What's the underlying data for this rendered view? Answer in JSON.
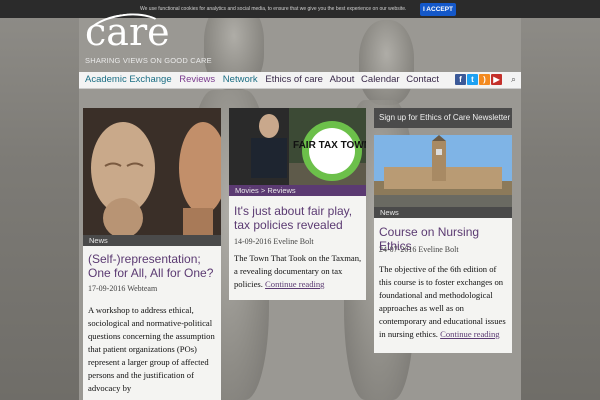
{
  "cookie": {
    "message": "We use functional cookies for analytics and social media, to ensure that we give you the best experience on our website.",
    "accept_label": "I ACCEPT"
  },
  "branding": {
    "logo_text": "care",
    "tagline": "SHARING VIEWS ON GOOD CARE"
  },
  "nav": {
    "left": [
      {
        "label": "Academic Exchange",
        "color": "#1a6e84"
      },
      {
        "label": "Reviews",
        "color": "#7a3a8e"
      },
      {
        "label": "Network",
        "color": "#1a6e84"
      }
    ],
    "right": [
      "Ethics of care",
      "About",
      "Calendar",
      "Contact"
    ],
    "social_icons": [
      "facebook-icon",
      "twitter-icon",
      "rss-icon",
      "youtube-icon"
    ]
  },
  "cards": [
    {
      "tag": "News",
      "title": "(Self-)representation; One for All, All for One?",
      "date": "17-09-2016",
      "author": "Webteam",
      "body": "A workshop to address ethical, sociological and normative-political questions concerning the assumption that patient organizations (POs) represent a larger group of affected persons and the justification of advocacy by"
    },
    {
      "tag_movies": "Movies",
      "tag_sep": ">",
      "tag_reviews": "Reviews",
      "image_sign": "FAIR TAX TOWN",
      "title": "It's just about fair play, tax policies revealed",
      "date": "14-09-2016",
      "author": "Eveline Bolt",
      "body": "The Town That Took on the Taxman, a revealing documentary on tax policies.",
      "more": "Continue reading"
    },
    {
      "tag": "News",
      "title": "Course on Nursing Ethics",
      "date": "24-07-2016",
      "author": "Eveline Bolt",
      "body": "The objective of the 6th edition of this course is to foster exchanges on foundational and methodological approaches as well as on contemporary and educational issues in nursing ethics.",
      "more": "Continue reading"
    }
  ],
  "sidebar": {
    "newsletter_label": "Sign up for Ethics of Care Newsletter"
  }
}
